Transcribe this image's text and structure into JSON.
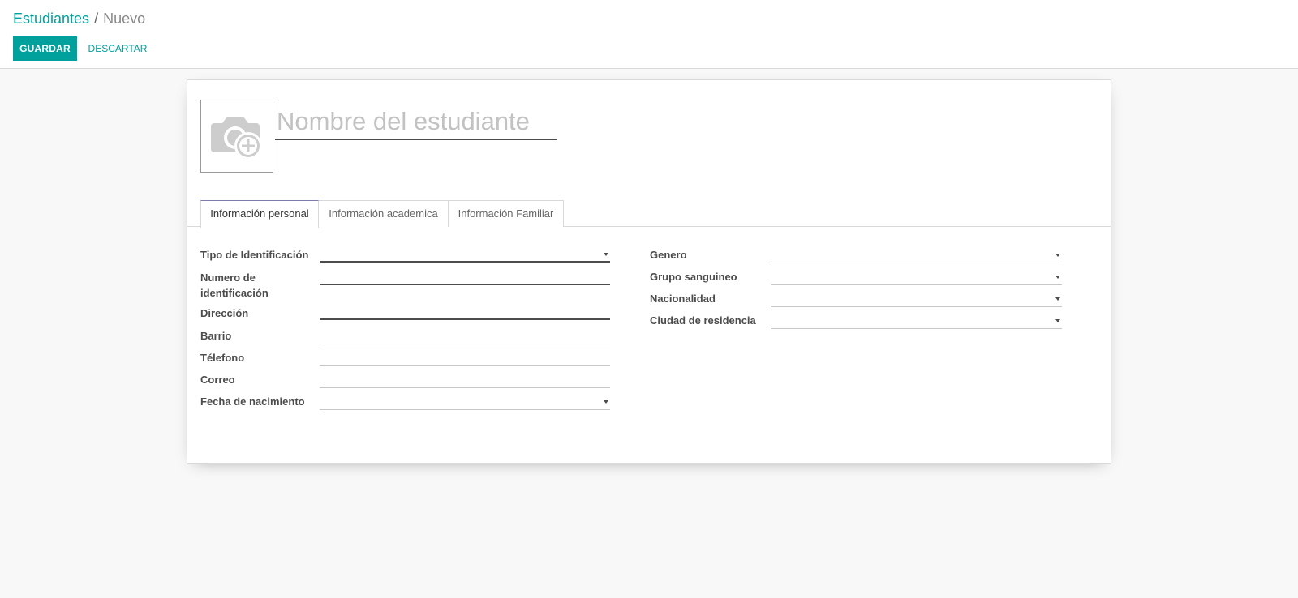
{
  "breadcrumb": {
    "parent": "Estudiantes",
    "separator": "/",
    "current": "Nuevo"
  },
  "toolbar": {
    "save_label": "GUARDAR",
    "discard_label": "DESCARTAR"
  },
  "form": {
    "name_placeholder": "Nombre del estudiante",
    "avatar_icon": "camera-plus-icon",
    "tabs": [
      {
        "label": "Información personal",
        "active": true
      },
      {
        "label": "Información academica",
        "active": false
      },
      {
        "label": "Información Familiar",
        "active": false
      }
    ],
    "left_fields": [
      {
        "label": "Tipo de Identificación",
        "value": "",
        "type": "select",
        "required": true
      },
      {
        "label": "Numero de identificación",
        "value": "",
        "type": "text",
        "required": true
      },
      {
        "label": "Dirección",
        "value": "",
        "type": "text",
        "required": true
      },
      {
        "label": "Barrio",
        "value": "",
        "type": "text",
        "required": false
      },
      {
        "label": "Télefono",
        "value": "",
        "type": "text",
        "required": false
      },
      {
        "label": "Correo",
        "value": "",
        "type": "text",
        "required": false
      },
      {
        "label": "Fecha de nacimiento",
        "value": "",
        "type": "date",
        "required": false
      }
    ],
    "right_fields": [
      {
        "label": "Genero",
        "value": "",
        "type": "select",
        "required": false
      },
      {
        "label": "Grupo sanguineo",
        "value": "",
        "type": "select",
        "required": false
      },
      {
        "label": "Nacionalidad",
        "value": "",
        "type": "select",
        "required": false
      },
      {
        "label": "Ciudad de residencia",
        "value": "",
        "type": "select",
        "required": false
      }
    ]
  },
  "colors": {
    "accent": "#00a09d",
    "tab_active_border": "#7c7bad"
  }
}
